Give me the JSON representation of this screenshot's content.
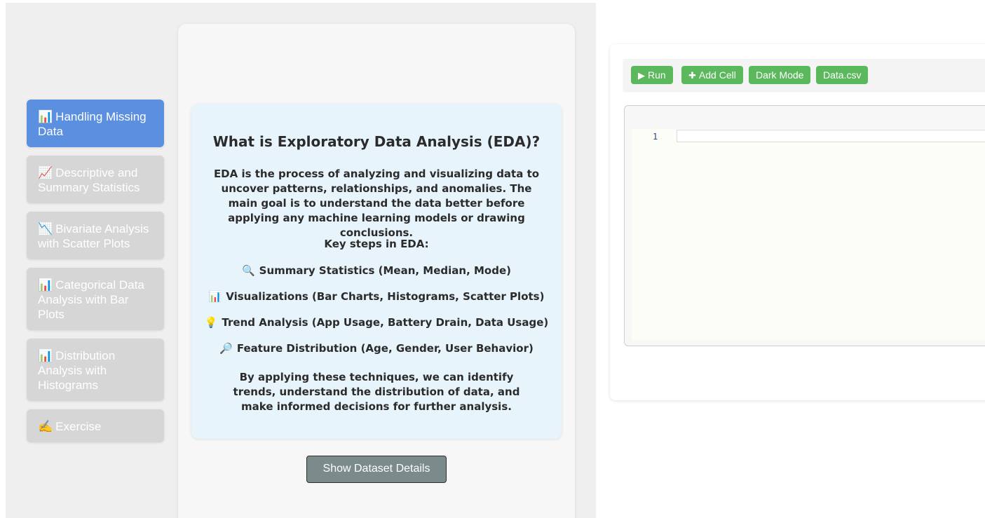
{
  "sidebar": {
    "items": [
      {
        "icon": "📊",
        "label": "Handling Missing Data",
        "active": true
      },
      {
        "icon": "📈",
        "label": "Descriptive and Summary Statistics",
        "active": false
      },
      {
        "icon": "📉",
        "label": "Bivariate Analysis with Scatter Plots",
        "active": false
      },
      {
        "icon": "📊",
        "label": "Categorical Data Analysis with Bar Plots",
        "active": false
      },
      {
        "icon": "📊",
        "label": "Distribution Analysis with Histograms",
        "active": false
      },
      {
        "icon": "✍️",
        "label": "Exercise",
        "active": false
      }
    ]
  },
  "content": {
    "title": "What is Exploratory Data Analysis (EDA)?",
    "intro": "EDA is the process of analyzing and visualizing data to uncover patterns, relationships, and anomalies. The main goal is to understand the data better before applying any machine learning models or drawing conclusions.",
    "key_steps_heading": "Key steps in EDA:",
    "steps": [
      {
        "icon": "🔍",
        "text": "Summary Statistics (Mean, Median, Mode)"
      },
      {
        "icon": "📊",
        "text": "Visualizations (Bar Charts, Histograms, Scatter Plots)"
      },
      {
        "icon": "💡",
        "text": "Trend Analysis (App Usage, Battery Drain, Data Usage)"
      },
      {
        "icon": "🔎",
        "text": "Feature Distribution (Age, Gender, User Behavior)"
      }
    ],
    "footer": "By applying these techniques, we can identify trends, understand the distribution of data, and make informed decisions for further analysis.",
    "show_button": "Show Dataset Details"
  },
  "notebook": {
    "toolbar": {
      "run_icon": "▶",
      "run_label": "Run",
      "add_icon": "✚",
      "add_label": "Add Cell",
      "dark_label": "Dark Mode",
      "data_label": "Data.csv"
    },
    "editor": {
      "line_number": "1",
      "code": ""
    }
  }
}
